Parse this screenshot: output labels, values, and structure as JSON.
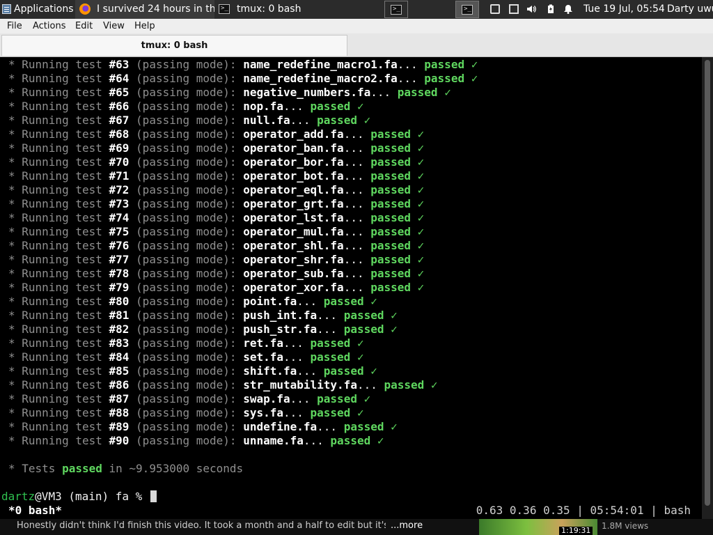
{
  "panel": {
    "applications_label": "Applications",
    "taskbar": [
      {
        "title": "I survived 24 hours in th...",
        "icon": "firefox-icon"
      },
      {
        "title": "tmux: 0 bash",
        "icon": "terminal-icon"
      }
    ],
    "clock": "Tue 19 Jul, 05:54",
    "user": "Darty uwu"
  },
  "menu": [
    "File",
    "Actions",
    "Edit",
    "View",
    "Help"
  ],
  "tab": {
    "title": "tmux: 0 bash"
  },
  "terminal": {
    "tests": [
      {
        "num": "#63",
        "file": "name_redefine_macro1.fa"
      },
      {
        "num": "#64",
        "file": "name_redefine_macro2.fa"
      },
      {
        "num": "#65",
        "file": "negative_numbers.fa"
      },
      {
        "num": "#66",
        "file": "nop.fa"
      },
      {
        "num": "#67",
        "file": "null.fa"
      },
      {
        "num": "#68",
        "file": "operator_add.fa"
      },
      {
        "num": "#69",
        "file": "operator_ban.fa"
      },
      {
        "num": "#70",
        "file": "operator_bor.fa"
      },
      {
        "num": "#71",
        "file": "operator_bot.fa"
      },
      {
        "num": "#72",
        "file": "operator_eql.fa"
      },
      {
        "num": "#73",
        "file": "operator_grt.fa"
      },
      {
        "num": "#74",
        "file": "operator_lst.fa"
      },
      {
        "num": "#75",
        "file": "operator_mul.fa"
      },
      {
        "num": "#76",
        "file": "operator_shl.fa"
      },
      {
        "num": "#77",
        "file": "operator_shr.fa"
      },
      {
        "num": "#78",
        "file": "operator_sub.fa"
      },
      {
        "num": "#79",
        "file": "operator_xor.fa"
      },
      {
        "num": "#80",
        "file": "point.fa"
      },
      {
        "num": "#81",
        "file": "push_int.fa"
      },
      {
        "num": "#82",
        "file": "push_str.fa"
      },
      {
        "num": "#83",
        "file": "ret.fa"
      },
      {
        "num": "#84",
        "file": "set.fa"
      },
      {
        "num": "#85",
        "file": "shift.fa"
      },
      {
        "num": "#86",
        "file": "str_mutability.fa"
      },
      {
        "num": "#87",
        "file": "swap.fa"
      },
      {
        "num": "#88",
        "file": "sys.fa"
      },
      {
        "num": "#89",
        "file": "undefine.fa"
      },
      {
        "num": "#90",
        "file": "unname.fa"
      }
    ],
    "line_prefix": "* Running test",
    "mode_text": "(passing mode):",
    "passed_word": "passed",
    "checkmark": "✓",
    "summary": {
      "prefix": "* Tests",
      "passed": "passed",
      "suffix": "in ~9.953000 seconds"
    },
    "prompt": {
      "user": "dartz",
      "host": "@VM3",
      "rest": " (main) fa % "
    }
  },
  "tmux_status": {
    "left": "*0 bash*",
    "right": "0.63 0.36 0.35 | 05:54:01 | bash"
  },
  "overlay": {
    "text": "Honestly didn't think I'd finish this video. It took a month and a half to edit but it's done",
    "more": "...more",
    "video_time": "1:19:31",
    "views": "1.8M views"
  },
  "colors": {
    "passed": "#5fd75f",
    "prompt_user": "#2fbf4f",
    "background": "#000000"
  }
}
